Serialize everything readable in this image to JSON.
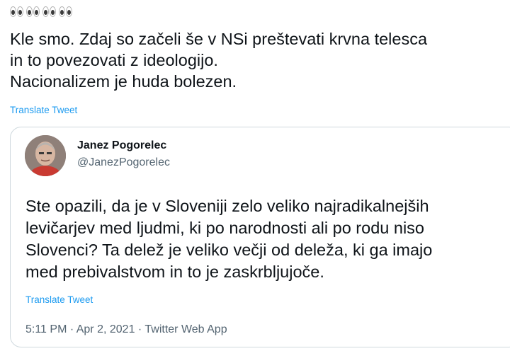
{
  "tweet": {
    "emoji": [
      "eyes",
      "eyes",
      "eyes",
      "eyes"
    ],
    "text_lines": [
      "Kle smo. Zdaj so začeli še v NSi preštevati krvna telesca",
      "in to povezovati z ideologijo.",
      "Nacionalizem je huda bolezen."
    ],
    "translate_label": "Translate Tweet"
  },
  "quoted_tweet": {
    "author_name": "Janez Pogorelec",
    "author_handle": "@JanezPogorelec",
    "text_lines": [
      "Ste opazili, da je v Sloveniji zelo veliko najradikalnejših",
      "levičarjev med ljudmi, ki po narodnosti ali po rodu niso",
      "Slovenci? Ta delež je veliko večji od deleža, ki ga imajo",
      "med prebivalstvom in to je zaskrbljujoče."
    ],
    "translate_label": "Translate Tweet",
    "timestamp": "5:11 PM · Apr 2, 2021 · Twitter Web App"
  },
  "colors": {
    "link": "#1d9bf0",
    "text": "#0f1419",
    "secondary": "#536471",
    "border": "#cfd9de"
  }
}
